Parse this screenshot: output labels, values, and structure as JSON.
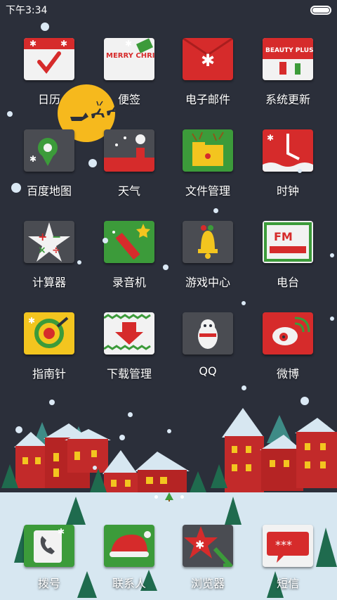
{
  "status_bar": {
    "time": "下午3:34"
  },
  "apps": [
    {
      "label": "日历",
      "icon": "calendar-icon"
    },
    {
      "label": "便签",
      "icon": "notes-icon",
      "icon_text": "MERRY CHRISTMAX"
    },
    {
      "label": "电子邮件",
      "icon": "mail-icon"
    },
    {
      "label": "系统更新",
      "icon": "system-update-icon",
      "icon_text": "BEAUTY PLUS"
    },
    {
      "label": "百度地图",
      "icon": "map-icon"
    },
    {
      "label": "天气",
      "icon": "weather-icon"
    },
    {
      "label": "文件管理",
      "icon": "folder-icon"
    },
    {
      "label": "时钟",
      "icon": "clock-icon"
    },
    {
      "label": "计算器",
      "icon": "calculator-icon"
    },
    {
      "label": "录音机",
      "icon": "recorder-icon"
    },
    {
      "label": "游戏中心",
      "icon": "game-center-icon"
    },
    {
      "label": "电台",
      "icon": "radio-icon",
      "icon_text": "FM"
    },
    {
      "label": "指南针",
      "icon": "compass-icon"
    },
    {
      "label": "下载管理",
      "icon": "download-icon"
    },
    {
      "label": "QQ",
      "icon": "qq-icon"
    },
    {
      "label": "微博",
      "icon": "weibo-icon"
    }
  ],
  "dock": [
    {
      "label": "拨号",
      "icon": "phone-icon"
    },
    {
      "label": "联系人",
      "icon": "contacts-icon"
    },
    {
      "label": "浏览器",
      "icon": "browser-icon"
    },
    {
      "label": "短信",
      "icon": "sms-icon",
      "icon_text": "***"
    }
  ],
  "colors": {
    "background": "#2b2f3a",
    "red": "#d62b2b",
    "green": "#3c9b3a",
    "yellow": "#f3c51f",
    "dark_gray": "#4a4c52",
    "paper": "#f2f2f2"
  }
}
